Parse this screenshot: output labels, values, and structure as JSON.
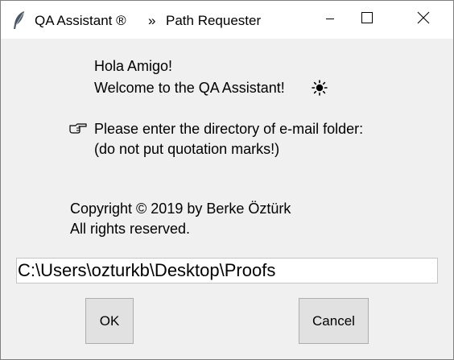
{
  "window": {
    "title": "QA Assistant ®",
    "separator": "»",
    "subtitle": "Path Requester",
    "controls": {
      "minimize_icon": "minimize-icon",
      "maximize_icon": "maximize-icon",
      "close_icon": "close-icon"
    }
  },
  "content": {
    "greeting": "Hola Amigo!",
    "welcome": "Welcome to the QA Assistant!",
    "welcome_icon": "sun-icon",
    "prompt_icon": "pointing-hand-icon",
    "prompt_line1": "Please enter the directory of e-mail folder:",
    "prompt_line2": "(do not put quotation marks!)",
    "copyright_line1": "Copyright © 2019 by Berke Öztürk",
    "copyright_line2": "All rights reserved."
  },
  "path_input": {
    "value": "C:\\Users\\ozturkb\\Desktop\\Proofs"
  },
  "buttons": {
    "ok_label": "OK",
    "cancel_label": "Cancel"
  },
  "colors": {
    "window_bg": "#f0f0f0",
    "titlebar_bg": "#ffffff",
    "button_bg": "#e1e1e1",
    "desktop_bg": "#6f8597"
  }
}
